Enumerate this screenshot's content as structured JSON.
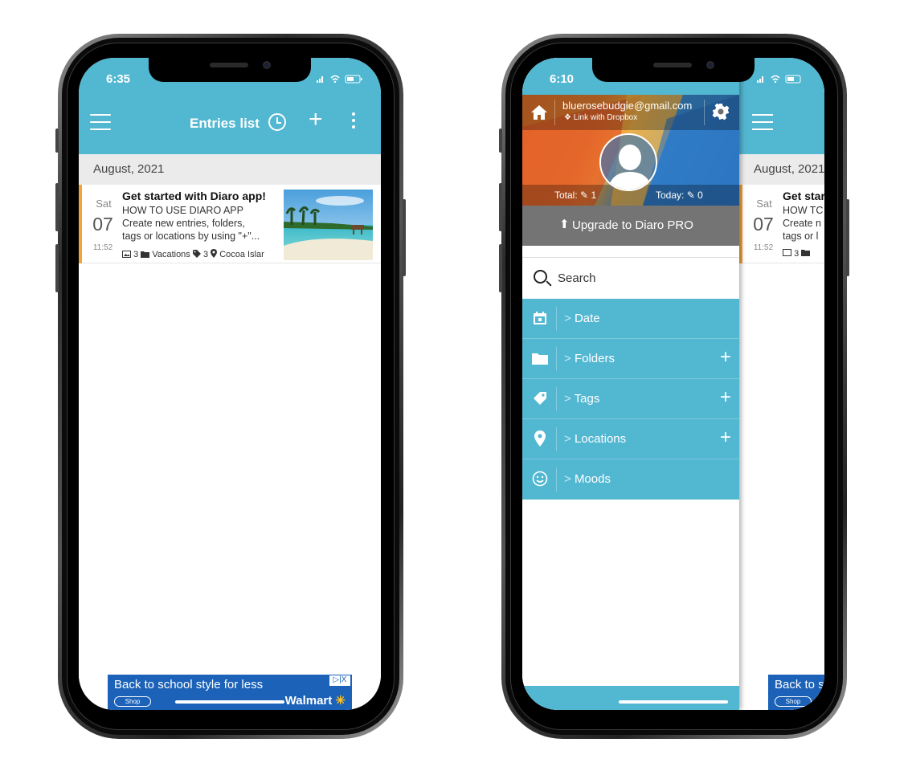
{
  "left_phone": {
    "status": {
      "time": "6:35",
      "icons": "..ıl ≈ ▭"
    },
    "appbar": {
      "title": "Entries list"
    },
    "month_header": "August, 2021",
    "entry": {
      "day_name": "Sat",
      "day_number": "07",
      "time": "11:52",
      "title": "Get started with Diaro app!",
      "line1": "HOW TO USE DIARO APP",
      "line2": "Create new entries, folders,",
      "line3": "tags or locations by using \"+\"...",
      "meta_photos": "3",
      "meta_folder": "Vacations",
      "meta_tags": "3",
      "meta_location": "Cocoa Islar"
    },
    "ad": {
      "text": "Back to school style for less",
      "button": "Shop",
      "brand": "Walmart",
      "close": "▷|X"
    }
  },
  "right_phone": {
    "status": {
      "time": "6:10"
    },
    "drawer": {
      "email": "bluerosebudgie@gmail.com",
      "dropbox": "Link with Dropbox",
      "total_label": "Total:",
      "total_value": "1",
      "today_label": "Today:",
      "today_value": "0",
      "upgrade": "Upgrade to Diaro PRO",
      "search": "Search",
      "menu": [
        {
          "label": "Date",
          "icon": "calendar-icon",
          "addable": false
        },
        {
          "label": "Folders",
          "icon": "folder-icon",
          "addable": true
        },
        {
          "label": "Tags",
          "icon": "tag-icon",
          "addable": true
        },
        {
          "label": "Locations",
          "icon": "location-pin-icon",
          "addable": true
        },
        {
          "label": "Moods",
          "icon": "smiley-icon",
          "addable": false
        }
      ],
      "chevron": ">",
      "add_symbol": "+"
    },
    "background_list": {
      "month_header": "August, 2021",
      "entry_day_name": "Sat",
      "entry_day_number": "07",
      "entry_time": "11:52",
      "entry_title": "Get star",
      "entry_line1": "HOW TC",
      "entry_line2": "Create n",
      "entry_line3": "tags or l",
      "ad_text": "Back to s",
      "ad_button": "Shop"
    }
  },
  "colors": {
    "primary": "#52b7d1",
    "accent": "#f2a33a",
    "ad_blue": "#1b62b8",
    "upgrade_gray": "#747474"
  }
}
